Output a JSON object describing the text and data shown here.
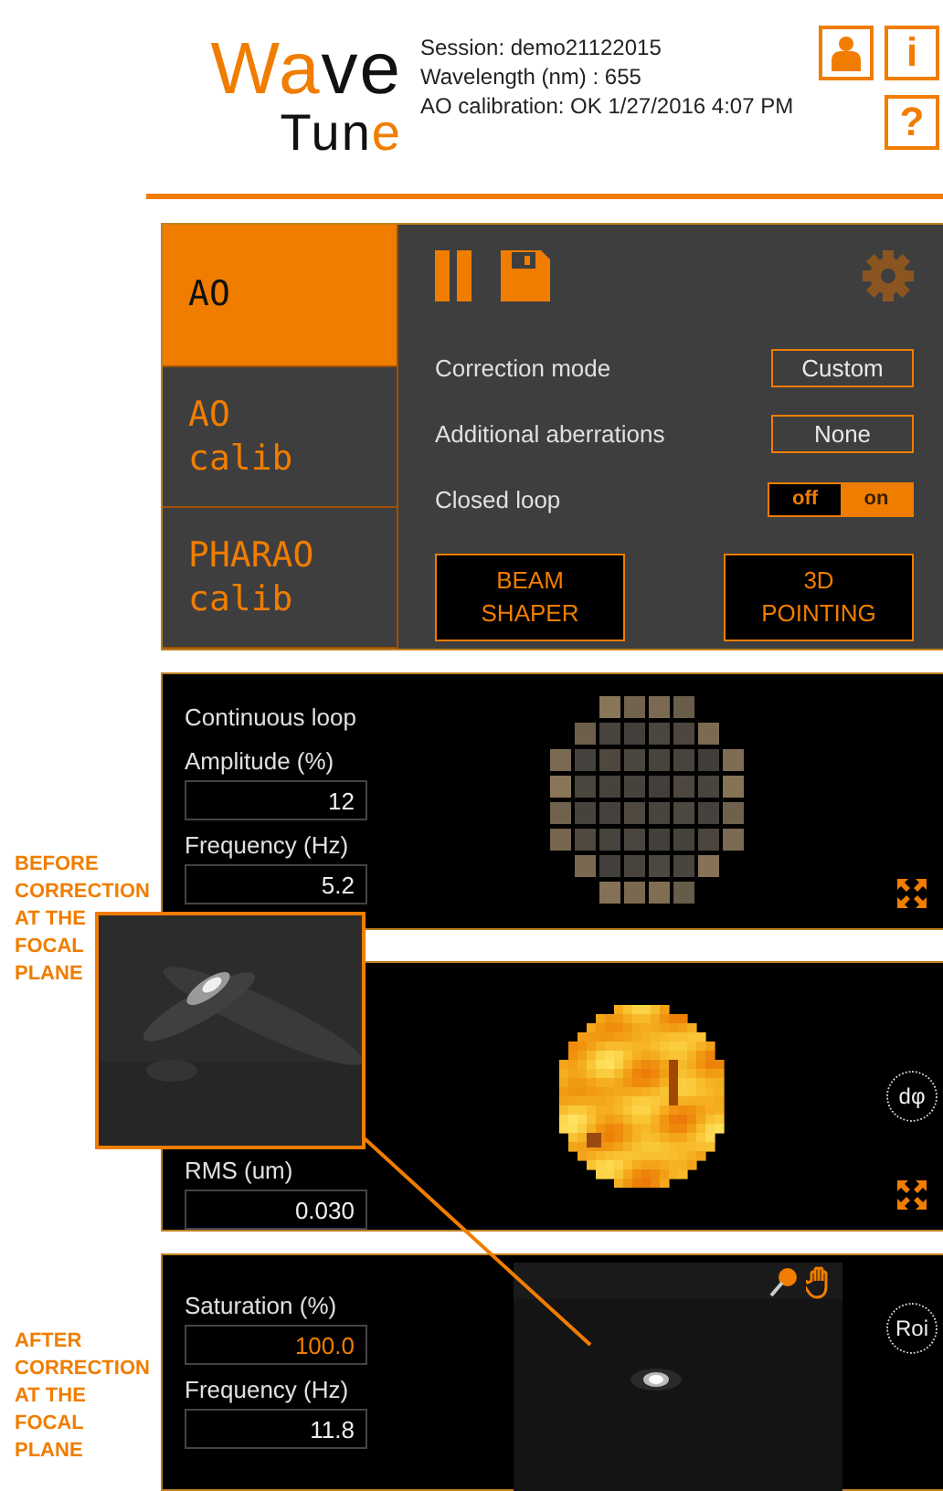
{
  "header": {
    "logo": [
      [
        {
          "text": "Wa",
          "accent": true
        },
        {
          "text": "ve",
          "accent": false
        }
      ],
      [
        {
          "text": "Tun",
          "accent": false
        },
        {
          "text": "e",
          "accent": true
        }
      ]
    ],
    "session_info": [
      "Session: demo21122015",
      "Wavelength (nm) : 655",
      "AO calibration: OK 1/27/2016 4:07 PM"
    ],
    "buttons": [
      {
        "kind": "user"
      },
      {
        "kind": "info",
        "label": "i"
      },
      {
        "kind": "help",
        "label": "?"
      }
    ]
  },
  "tabs": [
    {
      "label": "AO",
      "selected": true
    },
    {
      "label": "AO\ncalib",
      "selected": false
    },
    {
      "label": "PHARAO\ncalib",
      "selected": false
    }
  ],
  "settings": [
    {
      "kind": "select",
      "label": "Correction mode",
      "value": "Custom"
    },
    {
      "kind": "select",
      "label": "Additional aberrations",
      "value": "None"
    },
    {
      "kind": "toggle",
      "label": "Closed loop",
      "options": [
        "off",
        "on"
      ],
      "on": true
    }
  ],
  "action_buttons": [
    "BEAM\nSHAPER",
    "3D\nPOINTING"
  ],
  "loop_panel": {
    "title": "Continuous loop",
    "fields": [
      {
        "label": "Amplitude (%)",
        "value": "12",
        "alert": false
      },
      {
        "label": "Frequency (Hz)",
        "value": "5.2",
        "alert": false
      }
    ]
  },
  "wavefront_panel": {
    "fields": [
      {
        "label": "RMS (um)",
        "value": "0.030",
        "alert": false
      }
    ],
    "button": "dφ"
  },
  "camera_panel": {
    "fields": [
      {
        "label": "Saturation (%)",
        "value": "100.0",
        "alert": true
      },
      {
        "label": "Frequency (Hz)",
        "value": "11.8",
        "alert": false
      }
    ],
    "button": "Roi"
  },
  "annotations": [
    "BEFORE\nCORRECTION\nAT THE\nFOCAL\nPLANE",
    "AFTER\nCORRECTION\nAT THE\nFOCAL\nPLANE"
  ],
  "inset": {
    "kind": "picture"
  }
}
